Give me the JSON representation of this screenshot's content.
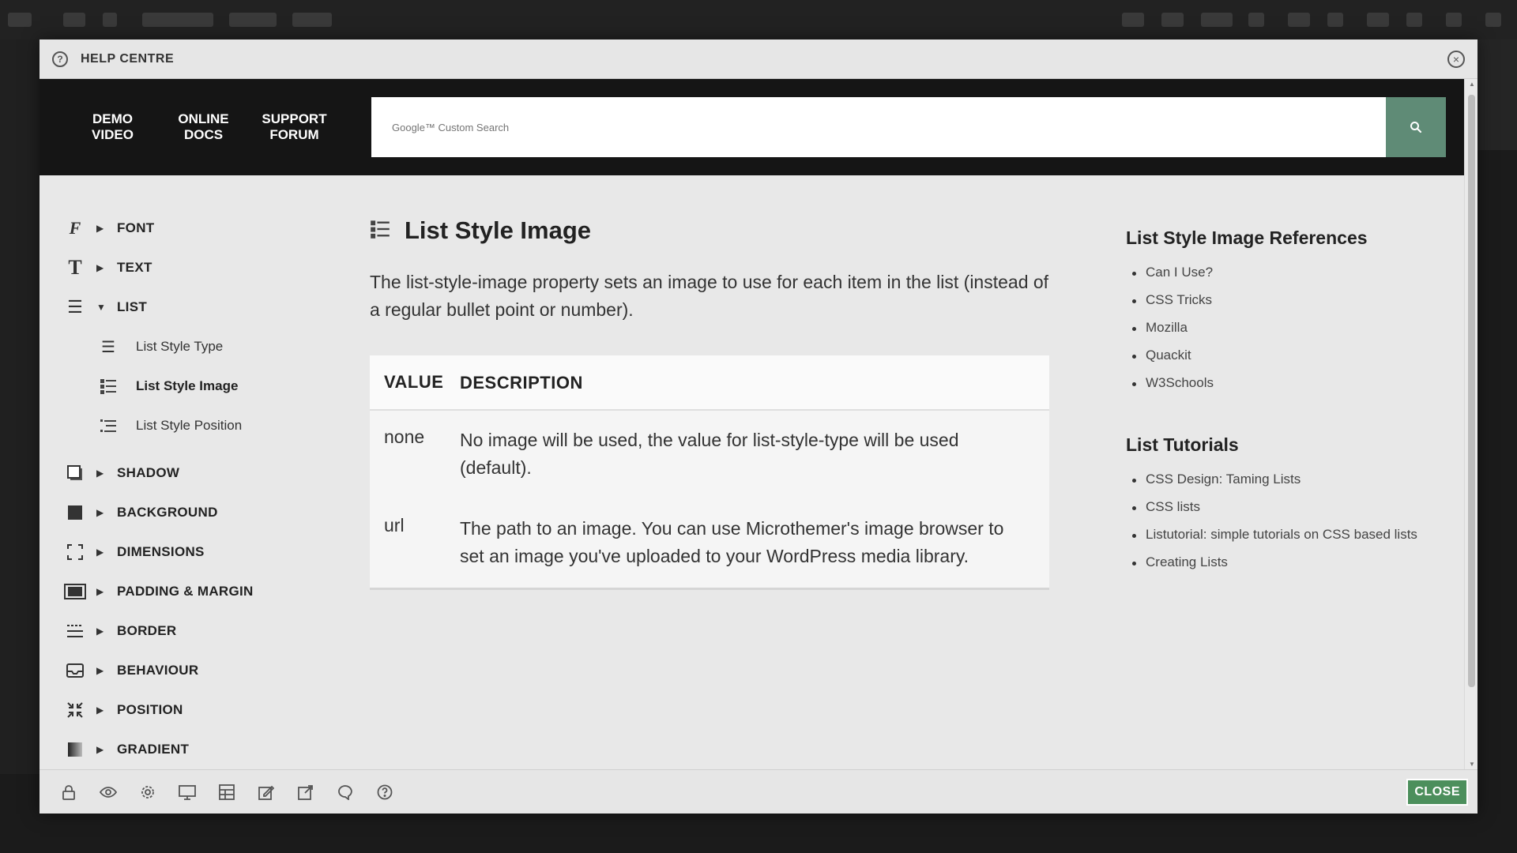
{
  "titlebar": {
    "title": "HELP CENTRE",
    "icon": "help-circle-icon",
    "close_icon": "close-circle-icon"
  },
  "topnav": {
    "items": [
      {
        "line1": "DEMO",
        "line2": "VIDEO"
      },
      {
        "line1": "ONLINE",
        "line2": "DOCS"
      },
      {
        "line1": "SUPPORT",
        "line2": "FORUM"
      }
    ]
  },
  "search": {
    "placeholder": "Google™ Custom Search",
    "button_icon": "search-icon"
  },
  "leftnav": {
    "font": "FONT",
    "text": "TEXT",
    "list": "LIST",
    "list_sub": [
      "List Style Type",
      "List Style Image",
      "List Style Position"
    ],
    "shadow": "SHADOW",
    "background": "BACKGROUND",
    "dimensions": "DIMENSIONS",
    "padding_margin": "PADDING & MARGIN",
    "border": "BORDER",
    "behaviour": "BEHAVIOUR",
    "position": "POSITION",
    "gradient": "GRADIENT"
  },
  "main": {
    "title": "List Style Image",
    "description": "The list-style-image property sets an image to use for each item in the list (instead of a regular bullet point or number).",
    "table": {
      "headers": [
        "VALUE",
        "DESCRIPTION"
      ],
      "rows": [
        {
          "value": "none",
          "description": "No image will be used, the value for list-style-type will be used (default)."
        },
        {
          "value": "url",
          "description": "The path to an image. You can use Microthemer's image browser to set an image you've uploaded to your WordPress media library."
        }
      ]
    }
  },
  "refs": {
    "title": "List Style Image References",
    "items": [
      "Can I Use?",
      "CSS Tricks",
      "Mozilla",
      "Quackit",
      "W3Schools"
    ]
  },
  "tutorials": {
    "title": "List Tutorials",
    "items": [
      "CSS Design: Taming Lists",
      "CSS lists",
      "Listutorial: simple tutorials on CSS based lists",
      "Creating Lists"
    ]
  },
  "footer": {
    "icons": [
      "lock-icon",
      "eye-icon",
      "gear-icon",
      "monitor-icon",
      "table-icon",
      "edit-icon",
      "export-icon",
      "chat-icon",
      "help-icon"
    ],
    "close_label": "CLOSE"
  },
  "colors": {
    "accent": "#5f8b76",
    "close_button": "#4c8f5c",
    "dark_bar": "#151515"
  }
}
